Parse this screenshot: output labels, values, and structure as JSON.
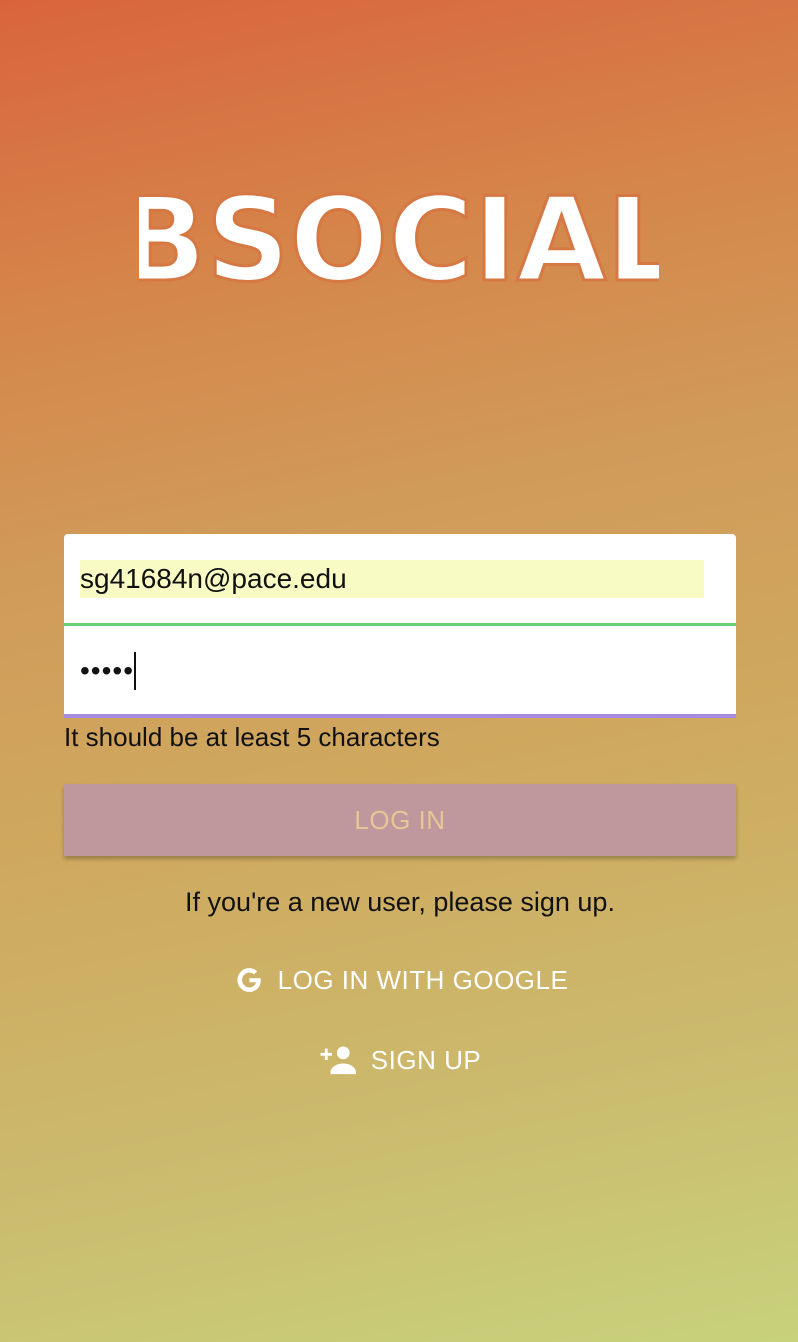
{
  "app": {
    "logo_text": "BSOCIAL"
  },
  "login_form": {
    "email_value": "sg41684n@pace.edu",
    "password_value": "•••••",
    "password_hint": "It should be at least 5 characters",
    "login_label": "LOG IN",
    "signup_prompt": "If you're a new user, please sign up.",
    "google_label": "LOG IN WITH GOOGLE",
    "signup_label": "SIGN UP"
  },
  "icons": {
    "google": "google-g-icon",
    "add_user": "person-add-icon"
  },
  "colors": {
    "gradient_top": "#d9643c",
    "gradient_bottom": "#c8d27b",
    "email_underline": "#6ccf78",
    "password_underline": "#a78be0",
    "login_button_bg": "#be989c",
    "login_button_text": "#e9c597",
    "autofill_bg": "#f8fcc4"
  }
}
